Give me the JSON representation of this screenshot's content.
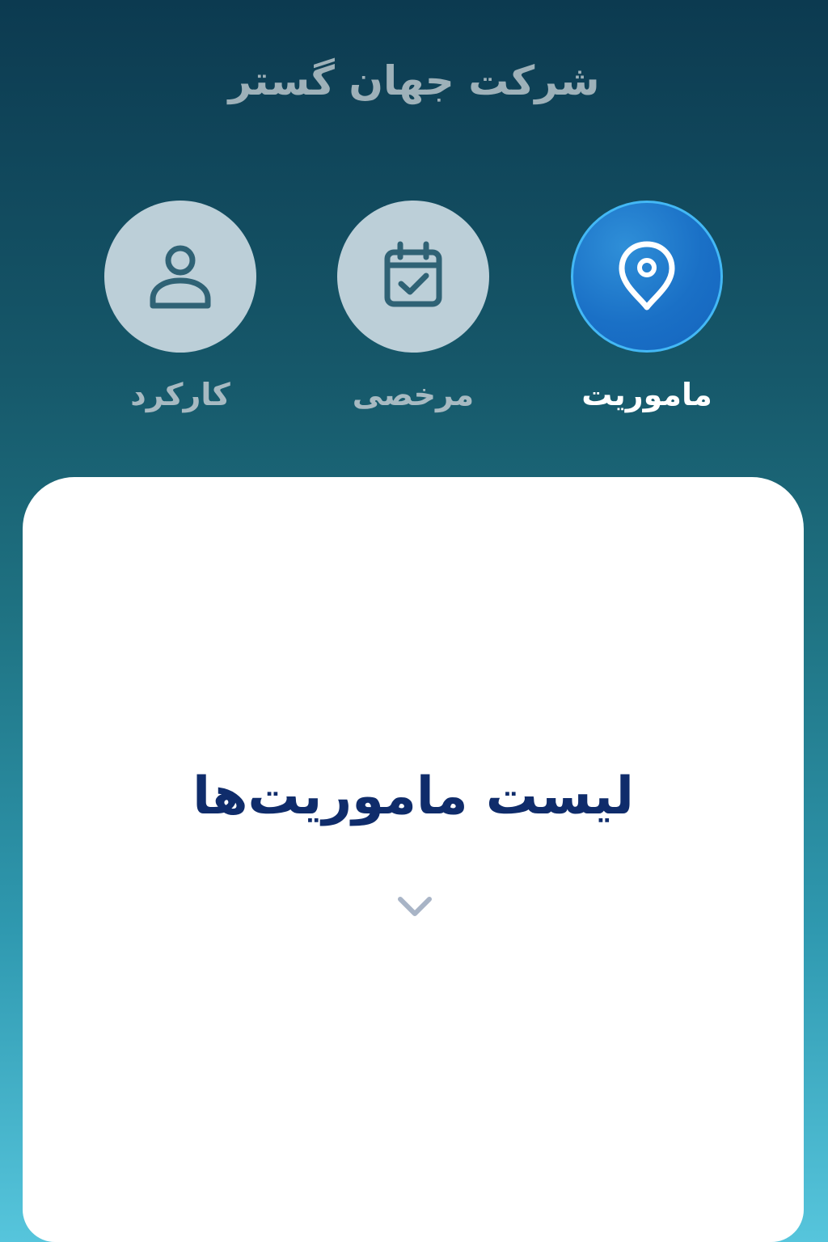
{
  "header": {
    "company_name": "شرکت جهان گستر"
  },
  "nav": {
    "items": [
      {
        "label": "ماموریت",
        "icon": "location-pin-icon",
        "active": true
      },
      {
        "label": "مرخصی",
        "icon": "calendar-check-icon",
        "active": false
      },
      {
        "label": "کارکرد",
        "icon": "user-icon",
        "active": false
      }
    ]
  },
  "main": {
    "title": "لیست ماموریت‌ها",
    "expand_icon": "chevron-down-icon"
  },
  "colors": {
    "active": "#1a70c6",
    "inactive_circle": "#bccfd8",
    "title_text": "#0f2c6b"
  }
}
